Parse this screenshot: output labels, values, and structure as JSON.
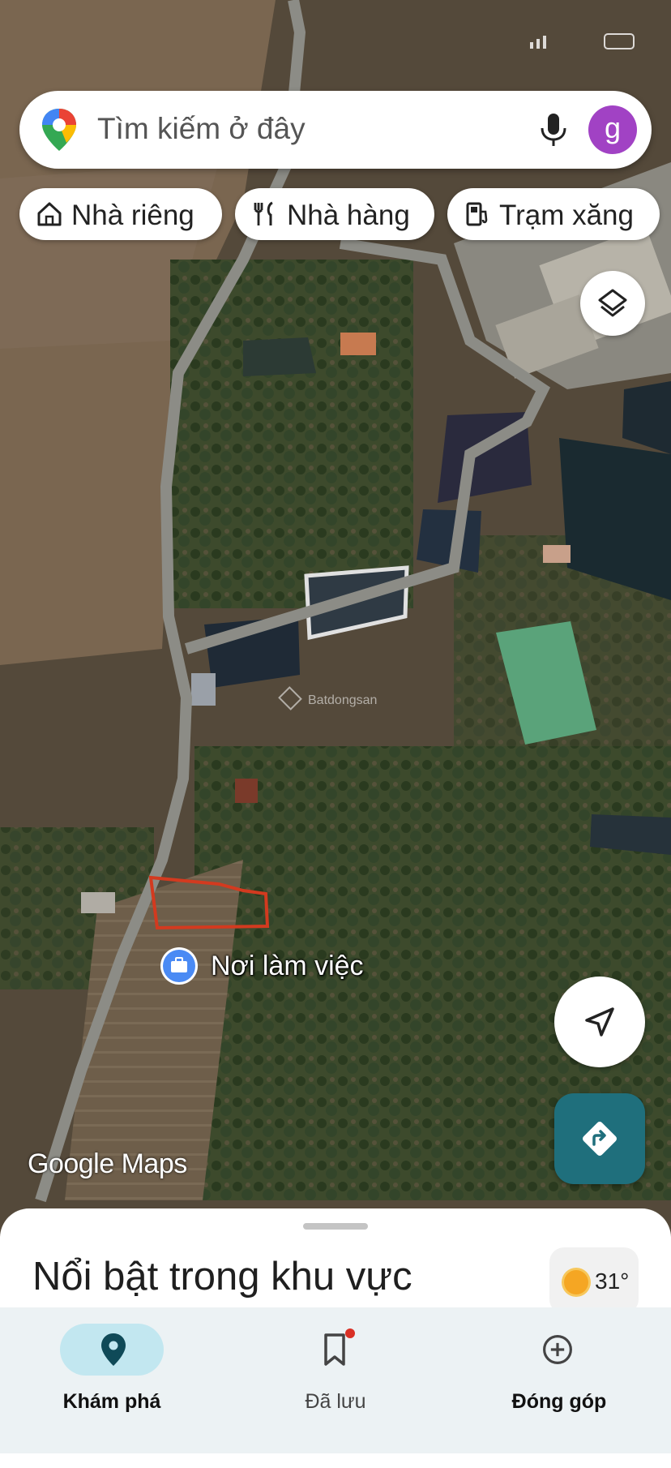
{
  "search": {
    "placeholder": "Tìm kiếm ở đây",
    "avatar_letter": "g"
  },
  "chips": [
    {
      "label": "Nhà riêng",
      "icon": "home-icon"
    },
    {
      "label": "Nhà hàng",
      "icon": "restaurant-icon"
    },
    {
      "label": "Trạm xăng",
      "icon": "gas-station-icon"
    }
  ],
  "map": {
    "place_label": "Nơi làm việc",
    "place_icon": "briefcase-icon",
    "logo": "Google Maps",
    "watermark": "Batdongsan"
  },
  "sheet": {
    "title": "Nổi bật trong khu vực",
    "temperature": "31°",
    "weather_icon": "sun-icon"
  },
  "nav": {
    "items": [
      {
        "label": "Khám phá",
        "icon": "explore-pin-icon",
        "active": true
      },
      {
        "label": "Đã lưu",
        "icon": "bookmark-icon",
        "active": false
      },
      {
        "label": "Đóng góp",
        "icon": "add-circle-icon",
        "active": false
      }
    ]
  },
  "colors": {
    "accent": "#1f6f7c",
    "avatar": "#a142c4",
    "nav_active_pill": "#c2e7f0",
    "boundary": "#d33a1f"
  }
}
